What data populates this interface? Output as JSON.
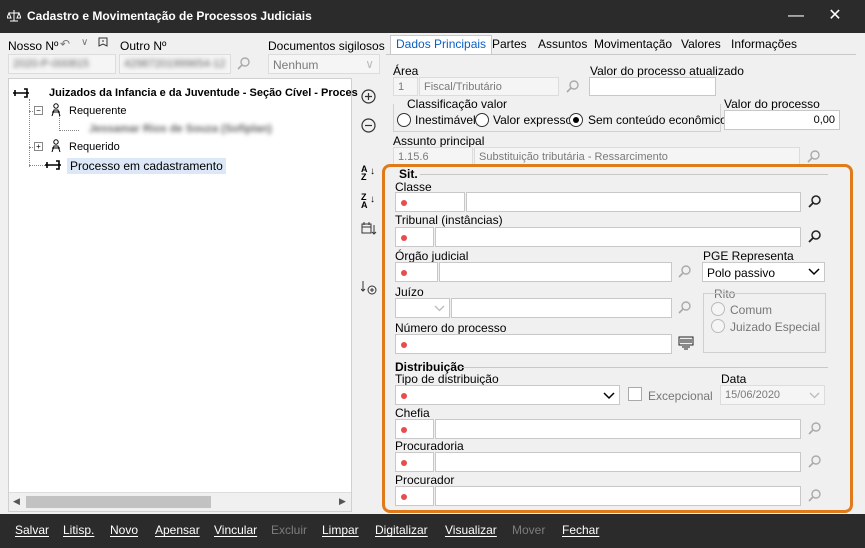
{
  "window": {
    "title": "Cadastro e Movimentação de Processos Judiciais"
  },
  "left": {
    "nosso_label": "Nosso Nº",
    "nosso_value": "2020-P-000815",
    "outro_label": "Outro Nº",
    "outro_value": "42987201999654-12",
    "docs_label": "Documentos sigilosos",
    "docs_value": "Nenhum",
    "tree": {
      "root": "Juizados da Infancia e da Juventude - Seção Cível - Proces",
      "requerente": "Requerente",
      "requerente_child": "Jessamar Rios de Souza (Sofiplan)",
      "requerido": "Requerido",
      "processo": "Processo em cadastramento"
    }
  },
  "tabs": [
    "Dados Principais",
    "Partes",
    "Assuntos",
    "Movimentação",
    "Valores",
    "Informações"
  ],
  "main": {
    "area_label": "Área",
    "area_code": "1",
    "area_name": "Fiscal/Tributário",
    "valor_atualizado_label": "Valor do processo atualizado",
    "classificacao_label": "Classificação valor",
    "radio_inestimavel": "Inestimável",
    "radio_expresso": "Valor expresso",
    "radio_sem": "Sem conteúdo econômico",
    "valor_processo_label": "Valor do processo",
    "valor_processo_value": "0,00",
    "assunto_label": "Assunto principal",
    "assunto_code": "1.15.6",
    "assunto_name": "Substituição tributária - Ressarcimento"
  },
  "sit": {
    "section_label": "Sit.",
    "classe_label": "Classe",
    "tribunal_label": "Tribunal (instâncias)",
    "orgao_label": "Órgão judicial",
    "pge_label": "PGE Representa",
    "pge_value": "Polo passivo",
    "juizo_label": "Juízo",
    "rito_label": "Rito",
    "rito_comum": "Comum",
    "rito_juizado": "Juizado Especial",
    "numero_label": "Número do processo"
  },
  "distribuicao": {
    "section_label": "Distribuição",
    "tipo_label": "Tipo de distribuição",
    "excepcional_label": "Excepcional",
    "data_label": "Data",
    "data_value": "15/06/2020",
    "chefia_label": "Chefia",
    "procuradoria_label": "Procuradoria",
    "procurador_label": "Procurador"
  },
  "bottom": {
    "salvar": "Salvar",
    "litisp": "Litisp.",
    "novo": "Novo",
    "apensar": "Apensar",
    "vincular": "Vincular",
    "excluir": "Excluir",
    "limpar": "Limpar",
    "digitalizar": "Digitalizar",
    "visualizar": "Visualizar",
    "mover": "Mover",
    "fechar": "Fechar"
  },
  "colors": {
    "accent": "#0a5ec8",
    "highlight": "#e07b1c",
    "required": "#e84c4c",
    "titlebar": "#2b2b2b"
  }
}
